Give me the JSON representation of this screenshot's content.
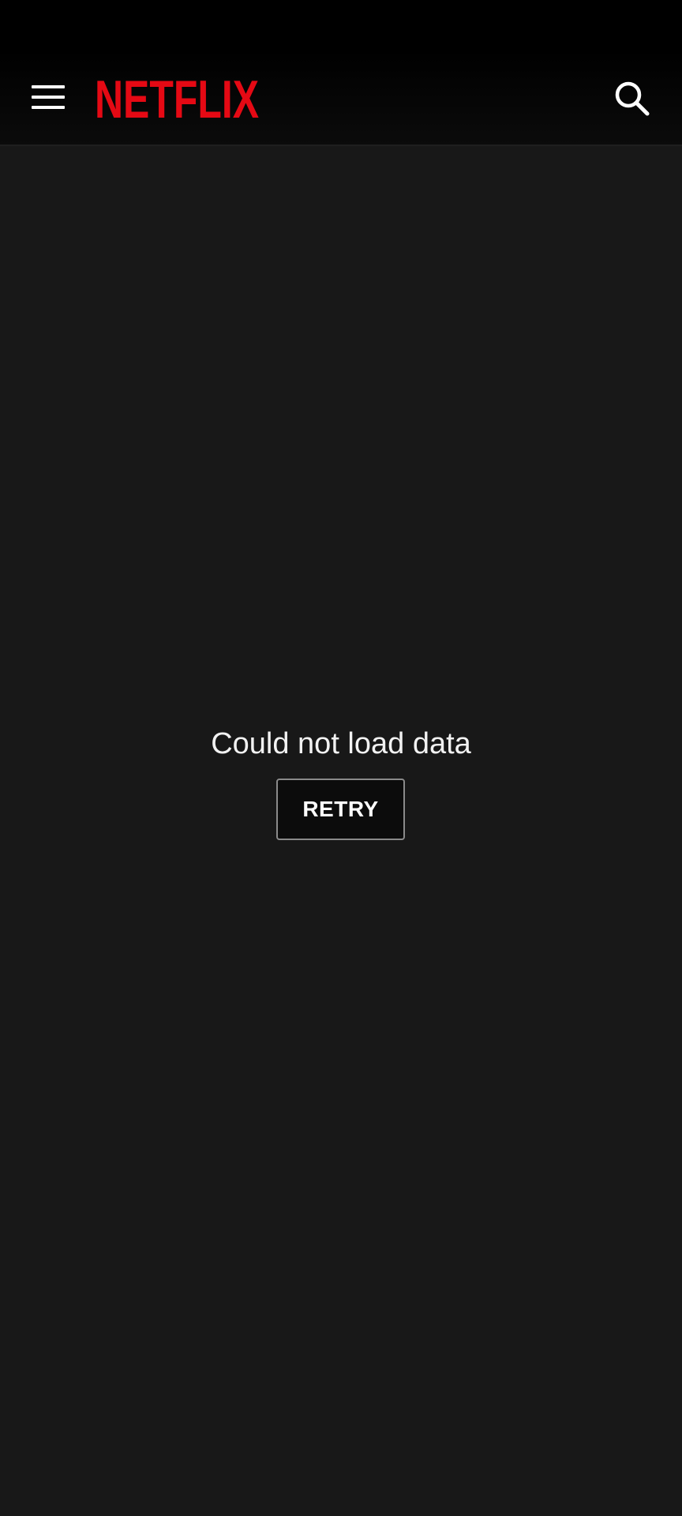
{
  "app": {
    "logo_text": "NETFLIX",
    "brand_color": "#E50914",
    "background_color": "#181818"
  },
  "header": {
    "menu_icon": "hamburger-menu-icon",
    "search_icon": "search-icon"
  },
  "main": {
    "error_message": "Could not load data",
    "retry_label": "RETRY"
  }
}
